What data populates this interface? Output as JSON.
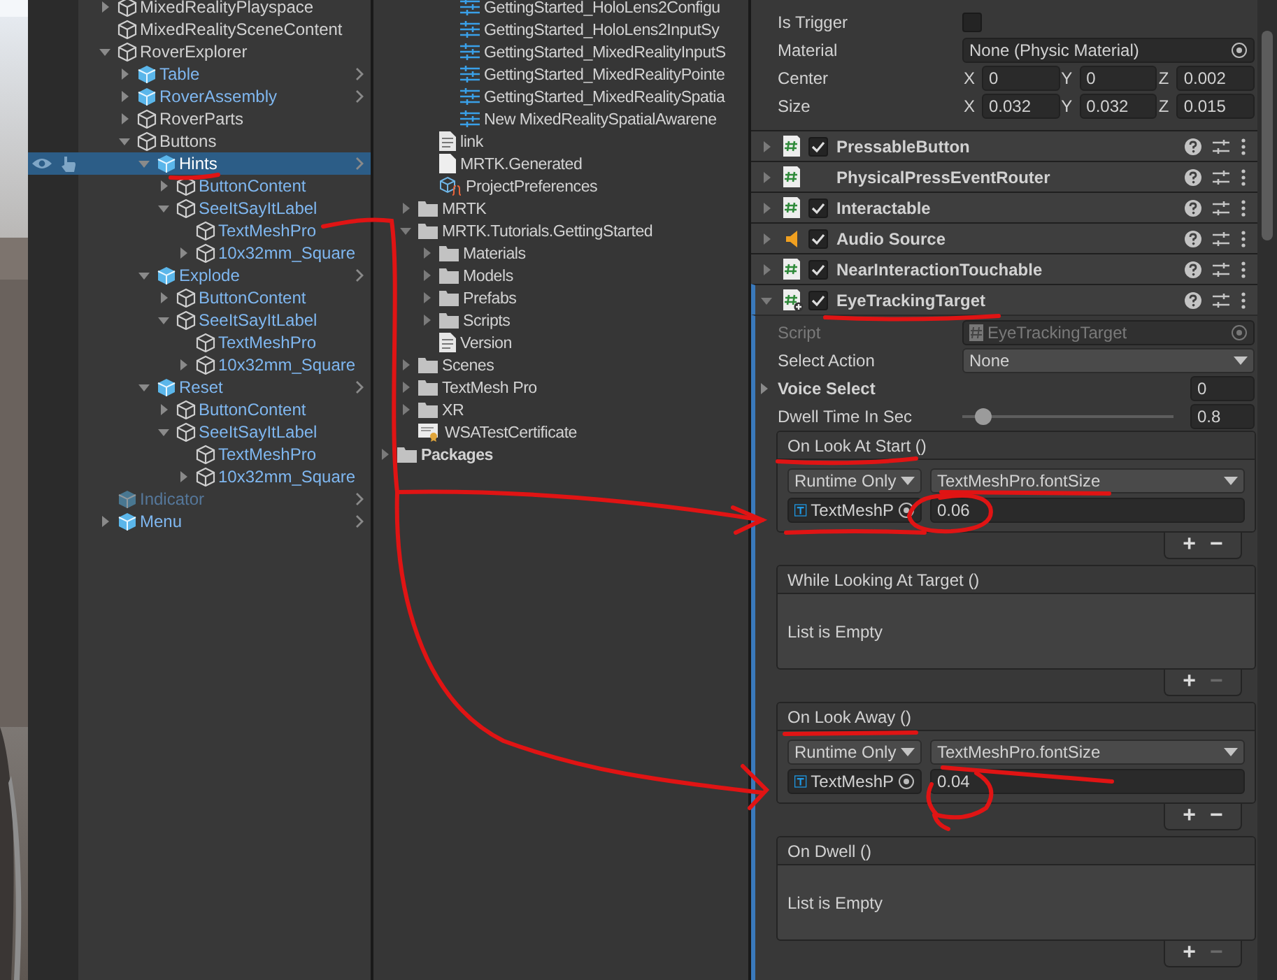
{
  "hierarchy": {
    "items": [
      {
        "name": "MixedRealityPlayspace",
        "kind": "object",
        "expanded": false,
        "selected": false,
        "active": true
      },
      {
        "name": "MixedRealitySceneContent",
        "kind": "object",
        "selected": false,
        "active": true
      },
      {
        "name": "RoverExplorer",
        "kind": "object",
        "expanded": true,
        "selected": false,
        "active": true,
        "children": [
          {
            "name": "Table",
            "kind": "prefab",
            "expanded": false,
            "selected": false,
            "active": true
          },
          {
            "name": "RoverAssembly",
            "kind": "prefab",
            "expanded": false,
            "selected": false,
            "active": true
          },
          {
            "name": "RoverParts",
            "kind": "object",
            "expanded": false,
            "selected": false,
            "active": true
          },
          {
            "name": "Buttons",
            "kind": "object",
            "expanded": true,
            "selected": false,
            "active": true,
            "children": [
              {
                "name": "Hints",
                "kind": "prefab",
                "expanded": true,
                "selected": true,
                "active": true,
                "children": [
                  {
                    "name": "ButtonContent",
                    "kind": "prefab-part",
                    "expanded": false,
                    "selected": false,
                    "active": true
                  },
                  {
                    "name": "SeeItSayItLabel",
                    "kind": "prefab-part",
                    "expanded": true,
                    "selected": false,
                    "active": true,
                    "children": [
                      {
                        "name": "TextMeshPro",
                        "kind": "prefab-part",
                        "selected": false,
                        "active": true
                      },
                      {
                        "name": "10x32mm_Square",
                        "kind": "prefab-part",
                        "expanded": false,
                        "selected": false,
                        "active": true
                      }
                    ]
                  }
                ]
              },
              {
                "name": "Explode",
                "kind": "prefab",
                "expanded": true,
                "selected": false,
                "active": true,
                "children": [
                  {
                    "name": "ButtonContent",
                    "kind": "prefab-part",
                    "expanded": false,
                    "selected": false,
                    "active": true
                  },
                  {
                    "name": "SeeItSayItLabel",
                    "kind": "prefab-part",
                    "expanded": true,
                    "selected": false,
                    "active": true,
                    "children": [
                      {
                        "name": "TextMeshPro",
                        "kind": "prefab-part",
                        "selected": false,
                        "active": true
                      },
                      {
                        "name": "10x32mm_Square",
                        "kind": "prefab-part",
                        "expanded": false,
                        "selected": false,
                        "active": true
                      }
                    ]
                  }
                ]
              },
              {
                "name": "Reset",
                "kind": "prefab",
                "expanded": true,
                "selected": false,
                "active": true,
                "children": [
                  {
                    "name": "ButtonContent",
                    "kind": "prefab-part",
                    "expanded": false,
                    "selected": false,
                    "active": true
                  },
                  {
                    "name": "SeeItSayItLabel",
                    "kind": "prefab-part",
                    "expanded": true,
                    "selected": false,
                    "active": true,
                    "children": [
                      {
                        "name": "TextMeshPro",
                        "kind": "prefab-part",
                        "selected": false,
                        "active": true
                      },
                      {
                        "name": "10x32mm_Square",
                        "kind": "prefab-part",
                        "expanded": false,
                        "selected": false,
                        "active": true
                      }
                    ]
                  }
                ]
              }
            ]
          }
        ]
      },
      {
        "name": "Indicator",
        "kind": "prefab",
        "selected": false,
        "active": false
      },
      {
        "name": "Menu",
        "kind": "prefab",
        "expanded": false,
        "selected": false,
        "active": true
      }
    ]
  },
  "project": {
    "items": [
      {
        "children": [
          {
            "children": [
              {
                "children": [
                  {
                    "name": "GettingStarted_HoloLens2Configu",
                    "kind": "config"
                  },
                  {
                    "name": "GettingStarted_HoloLens2InputSy",
                    "kind": "config"
                  },
                  {
                    "name": "GettingStarted_MixedRealityInputS",
                    "kind": "config"
                  },
                  {
                    "name": "GettingStarted_MixedRealityPointe",
                    "kind": "config"
                  },
                  {
                    "name": "GettingStarted_MixedRealitySpatia",
                    "kind": "config"
                  },
                  {
                    "name": "New MixedRealitySpatialAwarene",
                    "kind": "config"
                  }
                ]
              },
              {
                "name": "link",
                "kind": "text"
              },
              {
                "name": "MRTK.Generated",
                "kind": "file"
              },
              {
                "name": "ProjectPreferences",
                "kind": "preferences"
              }
            ]
          },
          {
            "name": "MRTK",
            "kind": "folder",
            "expanded": false
          },
          {
            "name": "MRTK.Tutorials.GettingStarted",
            "kind": "folder",
            "expanded": true,
            "children": [
              {
                "name": "Materials",
                "kind": "folder",
                "expanded": false
              },
              {
                "name": "Models",
                "kind": "folder",
                "expanded": false
              },
              {
                "name": "Prefabs",
                "kind": "folder",
                "expanded": false
              },
              {
                "name": "Scripts",
                "kind": "folder",
                "expanded": false
              },
              {
                "name": "Version",
                "kind": "text"
              }
            ]
          },
          {
            "name": "Scenes",
            "kind": "folder",
            "expanded": false
          },
          {
            "name": "TextMesh Pro",
            "kind": "folder",
            "expanded": false
          },
          {
            "name": "XR",
            "kind": "folder",
            "expanded": false
          },
          {
            "name": "WSATestCertificate",
            "kind": "certificate"
          }
        ]
      },
      {
        "name": "Packages",
        "kind": "folder",
        "expanded": false
      }
    ]
  },
  "inspector": {
    "collider_fields": [
      {
        "kind": "checkbox",
        "label": "Is Trigger",
        "checked": false
      },
      {
        "kind": "object",
        "label": "Material",
        "value": "None (Physic Material)"
      },
      {
        "kind": "vector3",
        "label": "Center",
        "components": [
          {
            "axis": "X",
            "value": "0"
          },
          {
            "axis": "Y",
            "value": "0"
          },
          {
            "axis": "Z",
            "value": "0.002"
          }
        ]
      },
      {
        "kind": "vector3",
        "label": "Size",
        "components": [
          {
            "axis": "X",
            "value": "0.032"
          },
          {
            "axis": "Y",
            "value": "0.032"
          },
          {
            "axis": "Z",
            "value": "0.015"
          }
        ]
      }
    ],
    "components": [
      {
        "name": "PressableButton",
        "kind": "script",
        "enabled": true,
        "expanded": false
      },
      {
        "name": "PhysicalPressEventRouter",
        "kind": "script",
        "expanded": false
      },
      {
        "name": "Interactable",
        "kind": "script",
        "enabled": true,
        "expanded": false
      },
      {
        "name": "Audio Source",
        "kind": "audio",
        "enabled": true,
        "expanded": false
      },
      {
        "name": "NearInteractionTouchable",
        "kind": "script",
        "enabled": true,
        "expanded": false
      },
      {
        "name": "EyeTrackingTarget",
        "kind": "added-script",
        "enabled": true,
        "expanded": true
      }
    ],
    "properties": [
      {
        "kind": "object",
        "label": "Script",
        "value": "EyeTrackingTarget",
        "disabled": true
      },
      {
        "kind": "dropdown",
        "label": "Select Action",
        "value": "None"
      },
      {
        "kind": "foldout",
        "label": "Voice Select",
        "value": "0",
        "expanded": false
      },
      {
        "kind": "slider",
        "label": "Dwell Time In Sec",
        "level": 0.1,
        "value": "0.8"
      }
    ],
    "events": [
      {
        "title": "On Look At Start ()",
        "entries": [
          {
            "mode": "Runtime Only",
            "function": "TextMeshPro.fontSize",
            "target": "TextMeshP",
            "value": "0.06"
          }
        ],
        "add": "+",
        "remove": "−"
      },
      {
        "title": "While Looking At Target ()",
        "empty_text": "List is Empty",
        "add": "+",
        "remove": "−"
      },
      {
        "title": "On Look Away ()",
        "entries": [
          {
            "mode": "Runtime Only",
            "function": "TextMeshPro.fontSize",
            "target": "TextMeshP",
            "value": "0.04"
          }
        ],
        "add": "+",
        "remove": "−"
      },
      {
        "title": "On Dwell ()",
        "empty_text": "List is Empty",
        "add": "+",
        "remove": "−"
      }
    ]
  }
}
